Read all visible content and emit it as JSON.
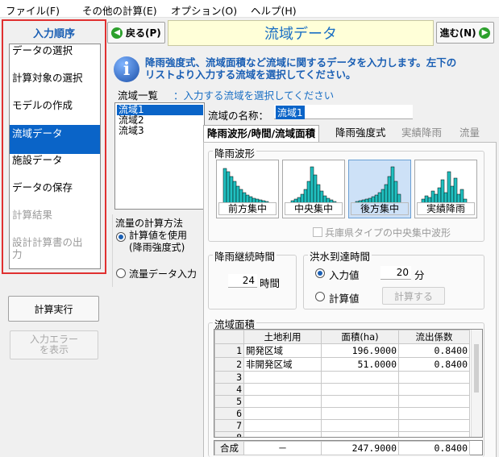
{
  "menubar": [
    "ファイル(F)",
    "その他の計算(E)",
    "オプション(O)",
    "ヘルプ(H)"
  ],
  "nav": {
    "title": "入力順序",
    "items": [
      {
        "label": "データの選択",
        "state": "normal"
      },
      {
        "label": "計算対象の選択",
        "state": "normal"
      },
      {
        "label": "モデルの作成",
        "state": "normal"
      },
      {
        "label": "流域データ",
        "state": "selected"
      },
      {
        "label": "施設データ",
        "state": "normal"
      },
      {
        "label": "データの保存",
        "state": "normal"
      },
      {
        "label": "計算結果",
        "state": "disabled"
      },
      {
        "label": "設計計算書の出",
        "label2": "力",
        "state": "disabled"
      }
    ],
    "run_button": "計算実行",
    "error_button_line1": "入力エラー",
    "error_button_line2": "を表示"
  },
  "header": {
    "back": "戻る(P)",
    "title": "流域データ",
    "next": "進む(N)"
  },
  "info": {
    "line1": "降雨強度式、流域面積など流域に関するデータを入力します。左下の",
    "line2": "リストより入力する流域を選択してください。"
  },
  "basin_list": {
    "label": "流域一覧",
    "hint": "：入力する流域を選択してください",
    "items": [
      "流域1",
      "流域2",
      "流域3"
    ],
    "selected": 0
  },
  "basin_name": {
    "label": "流域の名称：",
    "value": "流域1"
  },
  "flow_method": {
    "title": "流量の計算方法",
    "opt1_line1": "計算値を使用",
    "opt1_line2": "(降雨強度式)",
    "opt2": "流量データ入力",
    "selected": 0
  },
  "tabs": [
    "降雨波形/時間/流域面積",
    "降雨強度式",
    "実績降雨",
    "流量"
  ],
  "rain_pattern": {
    "title": "降雨波形",
    "patterns": [
      "前方集中",
      "中央集中",
      "後方集中",
      "実績降雨"
    ],
    "selected": 2,
    "hyogo_checkbox": "兵庫県タイプの中央集中波形"
  },
  "duration": {
    "title": "降雨継続時間",
    "value": "24",
    "unit": "時間"
  },
  "arrival": {
    "title": "洪水到達時間",
    "opt_input": "入力値",
    "input_value": "20",
    "unit": "分",
    "opt_calc": "計算値",
    "calc_button": "計算する"
  },
  "area": {
    "title": "流域面積",
    "columns": [
      "土地利用",
      "面積(ha)",
      "流出係数"
    ],
    "rows": [
      {
        "no": "1",
        "use": "開発区域",
        "area": "196.9000",
        "coef": "0.8400"
      },
      {
        "no": "2",
        "use": "非開発区域",
        "area": "51.0000",
        "coef": "0.8400"
      },
      {
        "no": "3",
        "use": "",
        "area": "",
        "coef": ""
      },
      {
        "no": "4",
        "use": "",
        "area": "",
        "coef": ""
      },
      {
        "no": "5",
        "use": "",
        "area": "",
        "coef": ""
      },
      {
        "no": "6",
        "use": "",
        "area": "",
        "coef": ""
      },
      {
        "no": "7",
        "use": "",
        "area": "",
        "coef": ""
      },
      {
        "no": "8",
        "use": "",
        "area": "",
        "coef": ""
      }
    ],
    "total": {
      "label": "合成",
      "use": "－",
      "area": "247.9000",
      "coef": "0.8400"
    }
  },
  "colors": {
    "accent_blue": "#1a5fb4",
    "selection": "#0a64c8",
    "highlight_frame": "#e03030",
    "title_bg": "#ffffd8"
  }
}
